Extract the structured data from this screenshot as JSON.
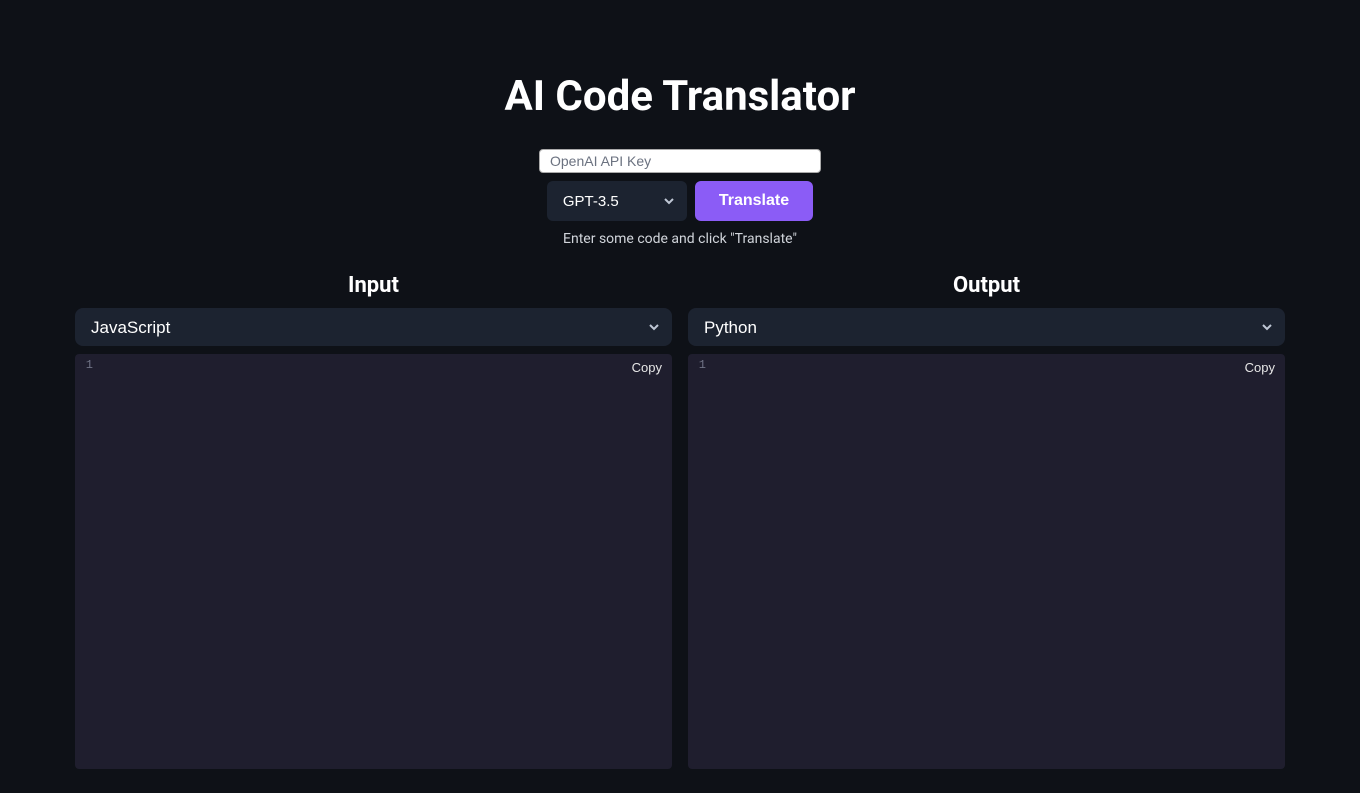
{
  "title": "AI Code Translator",
  "apiKey": {
    "placeholder": "OpenAI API Key",
    "value": ""
  },
  "controls": {
    "model_selected": "GPT-3.5",
    "translate_label": "Translate"
  },
  "hint": "Enter some code and click \"Translate\"",
  "input": {
    "title": "Input",
    "language_selected": "JavaScript",
    "copy_label": "Copy",
    "line_number": "1",
    "code": ""
  },
  "output": {
    "title": "Output",
    "language_selected": "Python",
    "copy_label": "Copy",
    "line_number": "1",
    "code": ""
  }
}
